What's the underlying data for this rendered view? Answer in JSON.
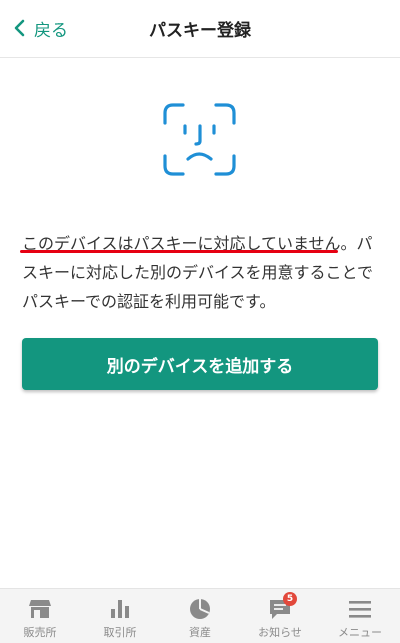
{
  "header": {
    "back_label": "戻る",
    "title": "パスキー登録"
  },
  "main": {
    "icon": "face-id-sad-icon",
    "message": "このデバイスはパスキーに対応していません。パスキーに対応した別のデバイスを用意することでパスキーでの認証を利用可能です。",
    "primary_button_label": "別のデバイスを追加する"
  },
  "tabbar": {
    "items": [
      {
        "label": "販売所",
        "icon": "store-icon"
      },
      {
        "label": "取引所",
        "icon": "bar-chart-icon"
      },
      {
        "label": "資産",
        "icon": "pie-chart-icon"
      },
      {
        "label": "お知らせ",
        "icon": "message-icon",
        "badge": "5"
      },
      {
        "label": "メニュー",
        "icon": "menu-icon"
      }
    ]
  },
  "colors": {
    "accent": "#13967f",
    "icon_blue": "#1f8fd6",
    "underline": "#e60012",
    "badge": "#e2483b"
  }
}
